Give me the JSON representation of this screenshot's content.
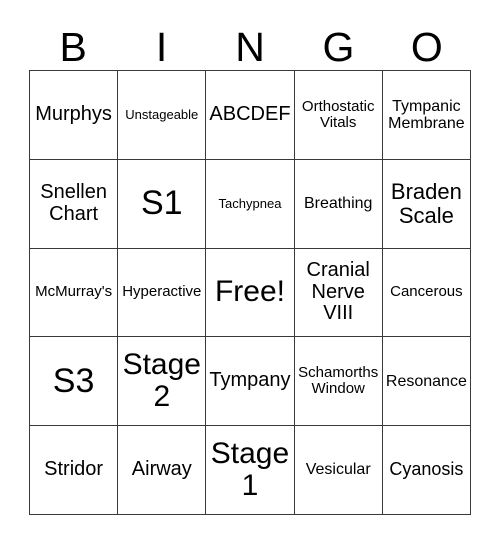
{
  "card": {
    "header_letters": [
      "B",
      "I",
      "N",
      "G",
      "O"
    ],
    "rows": [
      [
        {
          "label": "Murphys",
          "size": "fs-xl"
        },
        {
          "label": "Unstageable",
          "size": "fs-xs"
        },
        {
          "label": "ABCDEF",
          "size": "fs-xl"
        },
        {
          "label": "Orthostatic Vitals",
          "size": "fs-sm"
        },
        {
          "label": "Tympanic Membrane",
          "size": "fs-md"
        }
      ],
      [
        {
          "label": "Snellen Chart",
          "size": "fs-xl"
        },
        {
          "label": "S1",
          "size": "fs-5xl"
        },
        {
          "label": "Tachypnea",
          "size": "fs-xs"
        },
        {
          "label": "Breathing",
          "size": "fs-md"
        },
        {
          "label": "Braden Scale",
          "size": "fs-2xl"
        }
      ],
      [
        {
          "label": "McMurray's",
          "size": "fs-sm"
        },
        {
          "label": "Hyperactive",
          "size": "fs-sm"
        },
        {
          "label": "Free!",
          "size": "fs-4xl"
        },
        {
          "label": "Cranial Nerve VIII",
          "size": "fs-xl"
        },
        {
          "label": "Cancerous",
          "size": "fs-sm"
        }
      ],
      [
        {
          "label": "S3",
          "size": "fs-5xl"
        },
        {
          "label": "Stage 2",
          "size": "fs-4xl"
        },
        {
          "label": "Tympany",
          "size": "fs-xl"
        },
        {
          "label": "Schamorths Window",
          "size": "fs-sm"
        },
        {
          "label": "Resonance",
          "size": "fs-md"
        }
      ],
      [
        {
          "label": "Stridor",
          "size": "fs-xl"
        },
        {
          "label": "Airway",
          "size": "fs-xl"
        },
        {
          "label": "Stage 1",
          "size": "fs-4xl"
        },
        {
          "label": "Vesicular",
          "size": "fs-md"
        },
        {
          "label": "Cyanosis",
          "size": "fs-lg"
        }
      ]
    ]
  },
  "colors": {
    "border": "#3a3a3a",
    "text": "#000000",
    "background": "#ffffff"
  }
}
